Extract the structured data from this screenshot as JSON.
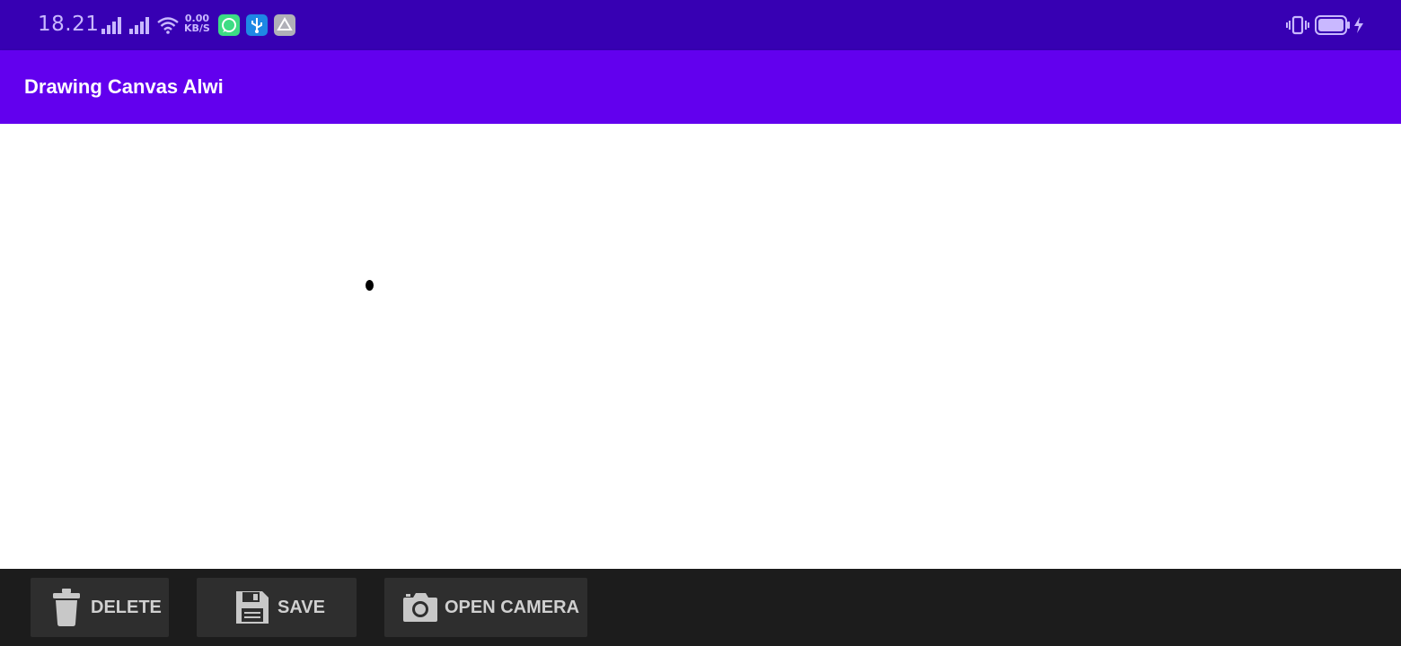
{
  "status_bar": {
    "time": "18.21",
    "net_speed_value": "0.00",
    "net_speed_unit": "KB/S",
    "icons": [
      "signal-1-icon",
      "signal-2-icon",
      "wifi-icon",
      "chat-app-icon",
      "usb-icon",
      "drive-app-icon",
      "vibrate-icon",
      "battery-icon",
      "charging-icon"
    ]
  },
  "app_bar": {
    "title": "Drawing Canvas Alwi",
    "color": "#6200ee"
  },
  "canvas": {
    "background": "#ffffff",
    "stroke_color": "#000000"
  },
  "toolbar": {
    "delete_label": "DELETE",
    "save_label": "SAVE",
    "camera_label": "OPEN CAMERA",
    "icons": [
      "trash-icon",
      "floppy-disk-icon",
      "camera-icon"
    ]
  }
}
